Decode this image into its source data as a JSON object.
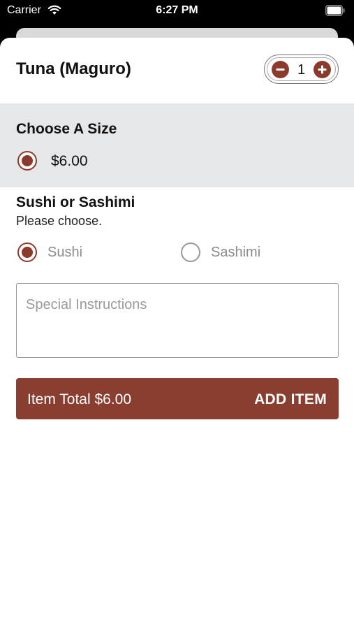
{
  "status_bar": {
    "carrier": "Carrier",
    "time": "6:27 PM"
  },
  "item": {
    "title": "Tuna (Maguro)",
    "quantity": "1"
  },
  "size_section": {
    "heading": "Choose A Size",
    "options": [
      {
        "label": "$6.00",
        "selected": true
      }
    ]
  },
  "style_section": {
    "heading": "Sushi or Sashimi",
    "subheading": "Please choose.",
    "options": [
      {
        "label": "Sushi",
        "selected": true
      },
      {
        "label": "Sashimi",
        "selected": false
      }
    ]
  },
  "instructions": {
    "placeholder": "Special Instructions",
    "value": ""
  },
  "add_button": {
    "total_label": "Item Total $6.00",
    "action_label": "ADD ITEM"
  },
  "colors": {
    "accent": "#8C3A2C",
    "section_bg": "#E6E7E8"
  },
  "icons": [
    "wifi-icon",
    "battery-icon",
    "minus-icon",
    "plus-icon",
    "radio-icon"
  ]
}
